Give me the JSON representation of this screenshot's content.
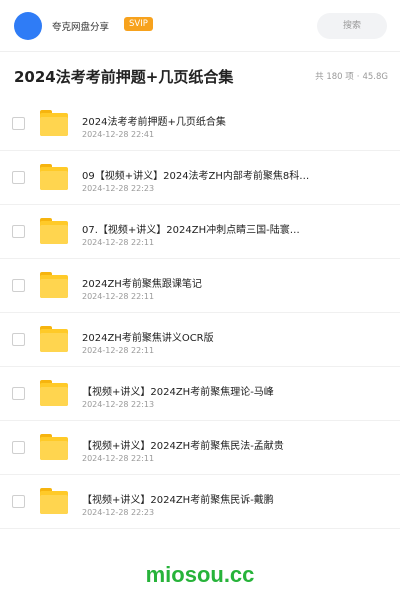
{
  "header": {
    "app_name": "夸克网盘分享",
    "badge": "SVIP",
    "search_placeholder": "搜索",
    "accent_color": "#2f7cf6"
  },
  "folder": {
    "title": "2024法考考前押题+几页纸合集",
    "item_count": "共 180 项",
    "separator": "·",
    "total_size": "45.8G"
  },
  "items": [
    {
      "name": "2024法考考前押题+几页纸合集",
      "date": "2024-12-28 22:41",
      "icon": "folder-icon"
    },
    {
      "name": "09【视频+讲义】2024法考ZH内部考前聚焦8科…",
      "date": "2024-12-28 22:23",
      "icon": "folder-icon"
    },
    {
      "name": "07.【视频+讲义】2024ZH冲刺点睛三国-陆寰…",
      "date": "2024-12-28 22:11",
      "icon": "folder-icon"
    },
    {
      "name": "2024ZH考前聚焦跟课笔记",
      "date": "2024-12-28 22:11",
      "icon": "folder-icon"
    },
    {
      "name": "2024ZH考前聚焦讲义OCR版",
      "date": "2024-12-28 22:11",
      "icon": "folder-icon"
    },
    {
      "name": "【视频+讲义】2024ZH考前聚焦理论-马峰",
      "date": "2024-12-28 22:13",
      "icon": "folder-icon"
    },
    {
      "name": "【视频+讲义】2024ZH考前聚焦民法-孟献贵",
      "date": "2024-12-28 22:11",
      "icon": "folder-icon"
    },
    {
      "name": "【视频+讲义】2024ZH考前聚焦民诉-戴鹏",
      "date": "2024-12-28 22:23",
      "icon": "folder-icon"
    }
  ],
  "watermark": "miosou.cc"
}
